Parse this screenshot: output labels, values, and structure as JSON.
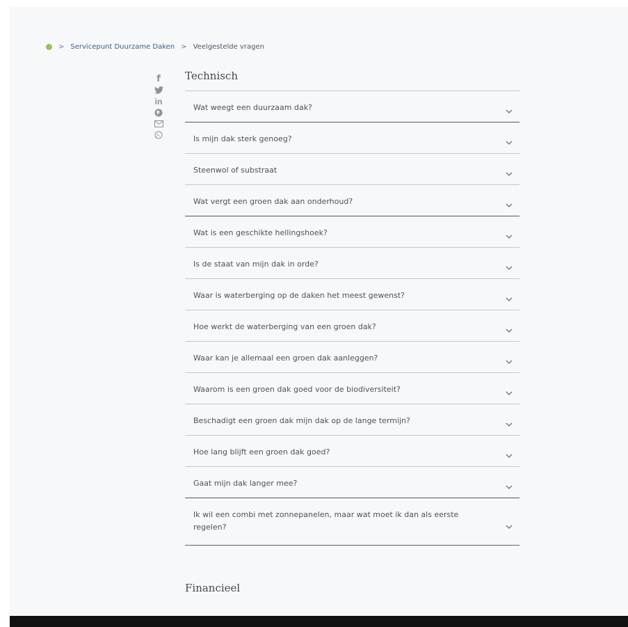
{
  "breadcrumb": {
    "home_icon": "home-icon",
    "separator": ">",
    "items": [
      "Servicepunt Duurzame Daken",
      "Veelgestelde vragen"
    ]
  },
  "share": {
    "icons": [
      "facebook-icon",
      "twitter-icon",
      "linkedin-icon",
      "pinterest-icon",
      "mail-icon",
      "whatsapp-icon"
    ],
    "facebook_glyph": "f",
    "linkedin_glyph": "in"
  },
  "sections": {
    "technisch": "Technisch",
    "financieel": "Financieel"
  },
  "faq": [
    "Wat weegt een duurzaam dak?",
    "Is mijn dak sterk genoeg?",
    "Steenwol of substraat",
    "Wat vergt een groen dak aan onderhoud?",
    "Wat is een geschikte hellingshoek?",
    "Is de staat van mijn dak in orde?",
    "Waar is waterberging op de daken het meest gewenst?",
    "Hoe werkt de waterberging van een groen dak?",
    "Waar kan je allemaal een groen dak aanleggen?",
    "Waarom is een groen dak goed voor de biodiversiteit?",
    "Beschadigt een groen dak mijn dak op de lange termijn?",
    "Hoe lang blijft een groen dak goed?",
    "Gaat mijn dak langer mee?",
    "Ik wil een combi met zonnepanelen, maar wat moet ik dan als eerste regelen?"
  ],
  "colors": {
    "accent_green": "#95c45a",
    "link_blue": "#3a5f86",
    "text": "#4c525a"
  }
}
